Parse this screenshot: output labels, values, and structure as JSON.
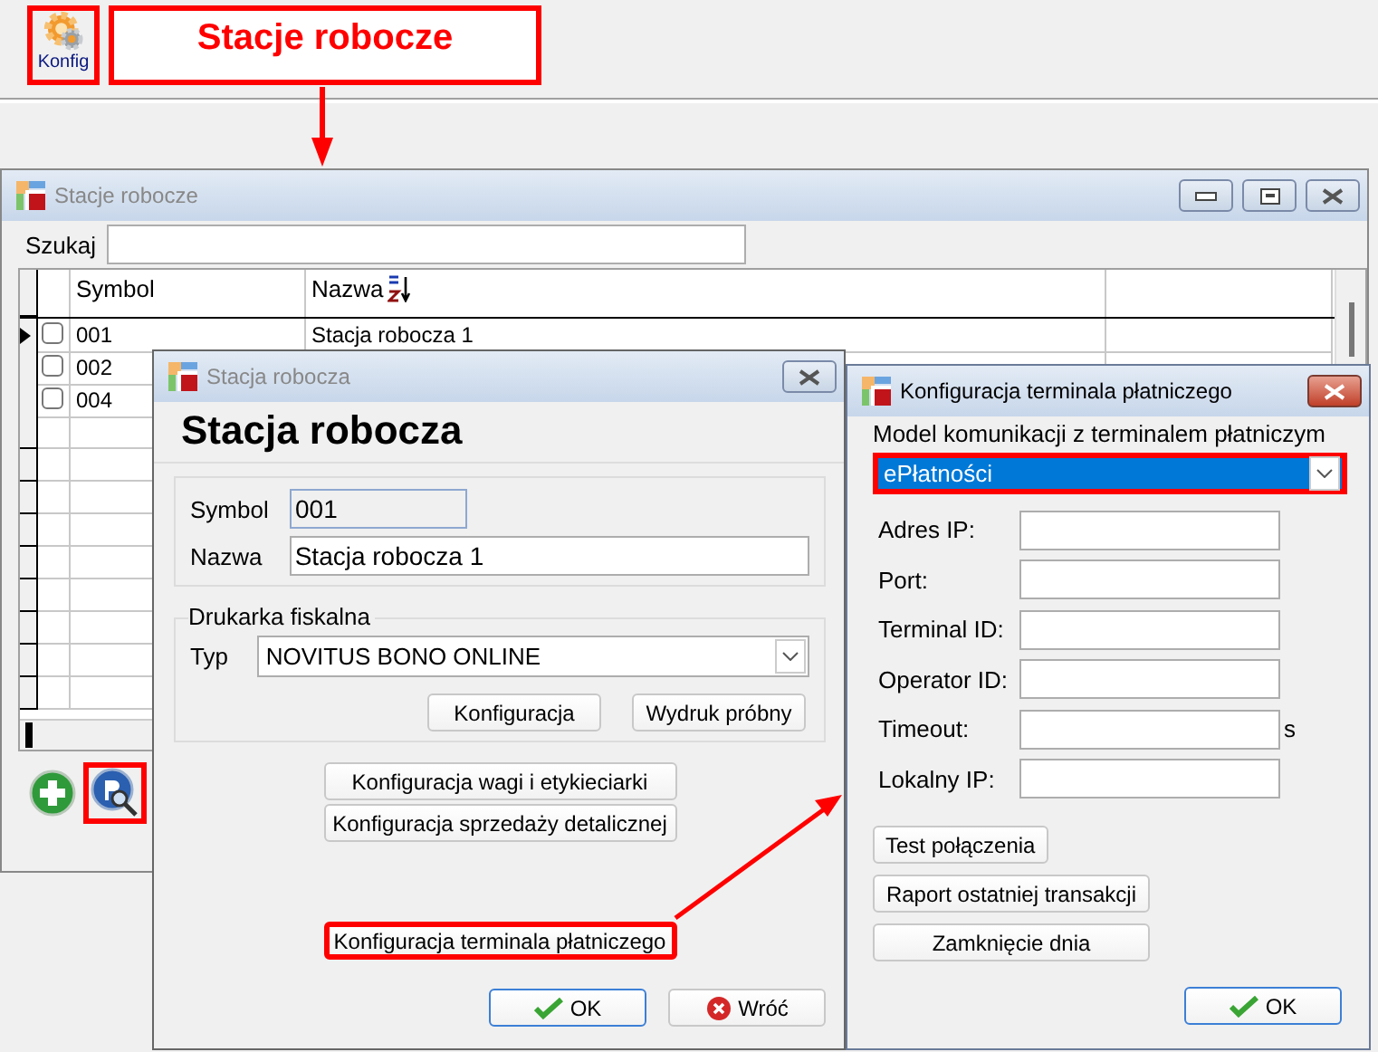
{
  "toolbar": {
    "button": {
      "label": "Konfig",
      "highlighted": true
    }
  },
  "annotation": {
    "label": "Stacje robocze"
  },
  "main_window": {
    "title": "Stacje robocze",
    "search": {
      "label": "Szukaj"
    },
    "table": {
      "columns": [
        {
          "label": "Symbol",
          "sorted": false
        },
        {
          "label": "Nazwa",
          "sorted": true
        }
      ],
      "rows": [
        {
          "symbol": "001",
          "name": "Stacja robocza 1",
          "checked": false,
          "selected": true
        },
        {
          "symbol": "002",
          "checked": false,
          "selected": false
        },
        {
          "symbol": "004",
          "checked": false,
          "selected": false
        }
      ]
    },
    "tools": [
      {
        "kind": "add",
        "highlighted": false
      },
      {
        "kind": "browse",
        "highlighted": true
      }
    ]
  },
  "dialog": {
    "title": "Stacja robocza",
    "heading": "Stacja robocza",
    "symbol": {
      "label": "Symbol",
      "value": "001"
    },
    "name": {
      "label": "Nazwa",
      "value": "Stacja robocza 1"
    },
    "fiscal_printer": {
      "legend": "Drukarka fiskalna",
      "type_label": "Typ",
      "type_value": "NOVITUS BONO ONLINE",
      "buttons": [
        "Konfiguracja",
        "Wydruk próbny"
      ]
    },
    "buttons": [
      {
        "label": "Konfiguracja wagi i etykieciarki",
        "highlighted": false
      },
      {
        "label": "Konfiguracja sprzedaży detalicznej",
        "highlighted": false
      },
      {
        "label": "Konfiguracja terminala płatniczego",
        "highlighted": true
      }
    ],
    "ok": "OK",
    "back": "Wróć"
  },
  "terminal_dialog": {
    "title": "Konfiguracja terminala płatniczego",
    "model_label": "Model komunikacji z terminalem płatniczym",
    "model": {
      "value": "ePłatności",
      "highlighted": true
    },
    "fields": [
      {
        "label": "Adres IP:"
      },
      {
        "label": "Port:"
      },
      {
        "label": "Terminal ID:"
      },
      {
        "label": "Operator ID:"
      },
      {
        "label": "Timeout:",
        "unit": "s"
      },
      {
        "label": "Lokalny IP:"
      }
    ],
    "buttons": [
      "Test połączenia",
      "Raport ostatniej transakcji",
      "Zamknięcie dnia"
    ],
    "ok": "OK"
  }
}
